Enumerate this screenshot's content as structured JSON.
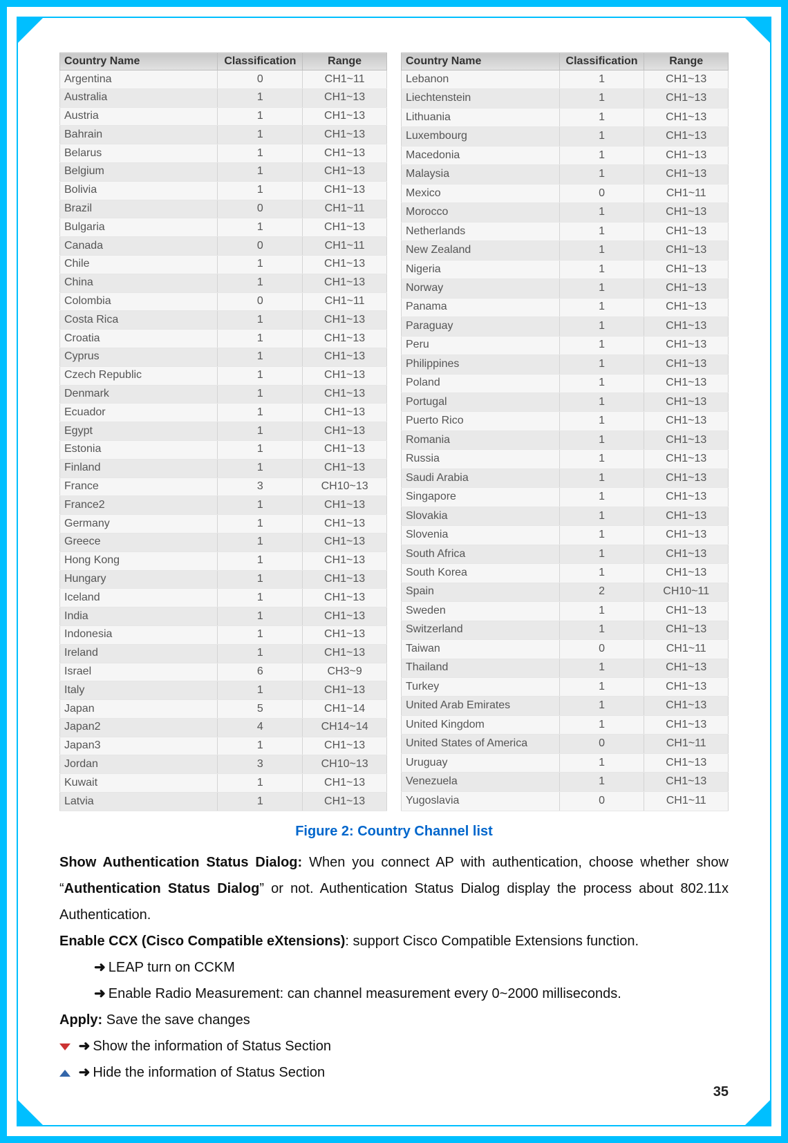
{
  "table": {
    "headers": {
      "country": "Country Name",
      "class": "Classification",
      "range": "Range"
    },
    "left": [
      {
        "n": "Argentina",
        "c": "0",
        "r": "CH1~11"
      },
      {
        "n": "Australia",
        "c": "1",
        "r": "CH1~13"
      },
      {
        "n": "Austria",
        "c": "1",
        "r": "CH1~13"
      },
      {
        "n": "Bahrain",
        "c": "1",
        "r": "CH1~13"
      },
      {
        "n": "Belarus",
        "c": "1",
        "r": "CH1~13"
      },
      {
        "n": "Belgium",
        "c": "1",
        "r": "CH1~13"
      },
      {
        "n": "Bolivia",
        "c": "1",
        "r": "CH1~13"
      },
      {
        "n": "Brazil",
        "c": "0",
        "r": "CH1~11"
      },
      {
        "n": "Bulgaria",
        "c": "1",
        "r": "CH1~13"
      },
      {
        "n": "Canada",
        "c": "0",
        "r": "CH1~11"
      },
      {
        "n": "Chile",
        "c": "1",
        "r": "CH1~13"
      },
      {
        "n": "China",
        "c": "1",
        "r": "CH1~13"
      },
      {
        "n": "Colombia",
        "c": "0",
        "r": "CH1~11"
      },
      {
        "n": "Costa Rica",
        "c": "1",
        "r": "CH1~13"
      },
      {
        "n": "Croatia",
        "c": "1",
        "r": "CH1~13"
      },
      {
        "n": "Cyprus",
        "c": "1",
        "r": "CH1~13"
      },
      {
        "n": "Czech Republic",
        "c": "1",
        "r": "CH1~13"
      },
      {
        "n": "Denmark",
        "c": "1",
        "r": "CH1~13"
      },
      {
        "n": "Ecuador",
        "c": "1",
        "r": "CH1~13"
      },
      {
        "n": "Egypt",
        "c": "1",
        "r": "CH1~13"
      },
      {
        "n": "Estonia",
        "c": "1",
        "r": "CH1~13"
      },
      {
        "n": "Finland",
        "c": "1",
        "r": "CH1~13"
      },
      {
        "n": "France",
        "c": "3",
        "r": "CH10~13"
      },
      {
        "n": "France2",
        "c": "1",
        "r": "CH1~13"
      },
      {
        "n": "Germany",
        "c": "1",
        "r": "CH1~13"
      },
      {
        "n": "Greece",
        "c": "1",
        "r": "CH1~13"
      },
      {
        "n": "Hong Kong",
        "c": "1",
        "r": "CH1~13"
      },
      {
        "n": "Hungary",
        "c": "1",
        "r": "CH1~13"
      },
      {
        "n": "Iceland",
        "c": "1",
        "r": "CH1~13"
      },
      {
        "n": "India",
        "c": "1",
        "r": "CH1~13"
      },
      {
        "n": "Indonesia",
        "c": "1",
        "r": "CH1~13"
      },
      {
        "n": "Ireland",
        "c": "1",
        "r": "CH1~13"
      },
      {
        "n": "Israel",
        "c": "6",
        "r": "CH3~9"
      },
      {
        "n": "Italy",
        "c": "1",
        "r": "CH1~13"
      },
      {
        "n": "Japan",
        "c": "5",
        "r": "CH1~14"
      },
      {
        "n": "Japan2",
        "c": "4",
        "r": "CH14~14"
      },
      {
        "n": "Japan3",
        "c": "1",
        "r": "CH1~13"
      },
      {
        "n": "Jordan",
        "c": "3",
        "r": "CH10~13"
      },
      {
        "n": "Kuwait",
        "c": "1",
        "r": "CH1~13"
      },
      {
        "n": "Latvia",
        "c": "1",
        "r": "CH1~13"
      }
    ],
    "right": [
      {
        "n": "Lebanon",
        "c": "1",
        "r": "CH1~13"
      },
      {
        "n": "Liechtenstein",
        "c": "1",
        "r": "CH1~13"
      },
      {
        "n": "Lithuania",
        "c": "1",
        "r": "CH1~13"
      },
      {
        "n": "Luxembourg",
        "c": "1",
        "r": "CH1~13"
      },
      {
        "n": "Macedonia",
        "c": "1",
        "r": "CH1~13"
      },
      {
        "n": "Malaysia",
        "c": "1",
        "r": "CH1~13"
      },
      {
        "n": "Mexico",
        "c": "0",
        "r": "CH1~11"
      },
      {
        "n": "Morocco",
        "c": "1",
        "r": "CH1~13"
      },
      {
        "n": "Netherlands",
        "c": "1",
        "r": "CH1~13"
      },
      {
        "n": "New Zealand",
        "c": "1",
        "r": "CH1~13"
      },
      {
        "n": "Nigeria",
        "c": "1",
        "r": "CH1~13"
      },
      {
        "n": "Norway",
        "c": "1",
        "r": "CH1~13"
      },
      {
        "n": "Panama",
        "c": "1",
        "r": "CH1~13"
      },
      {
        "n": "Paraguay",
        "c": "1",
        "r": "CH1~13"
      },
      {
        "n": "Peru",
        "c": "1",
        "r": "CH1~13"
      },
      {
        "n": "Philippines",
        "c": "1",
        "r": "CH1~13"
      },
      {
        "n": "Poland",
        "c": "1",
        "r": "CH1~13"
      },
      {
        "n": "Portugal",
        "c": "1",
        "r": "CH1~13"
      },
      {
        "n": "Puerto Rico",
        "c": "1",
        "r": "CH1~13"
      },
      {
        "n": "Romania",
        "c": "1",
        "r": "CH1~13"
      },
      {
        "n": "Russia",
        "c": "1",
        "r": "CH1~13"
      },
      {
        "n": "Saudi Arabia",
        "c": "1",
        "r": "CH1~13"
      },
      {
        "n": "Singapore",
        "c": "1",
        "r": "CH1~13"
      },
      {
        "n": "Slovakia",
        "c": "1",
        "r": "CH1~13"
      },
      {
        "n": "Slovenia",
        "c": "1",
        "r": "CH1~13"
      },
      {
        "n": "South Africa",
        "c": "1",
        "r": "CH1~13"
      },
      {
        "n": "South Korea",
        "c": "1",
        "r": "CH1~13"
      },
      {
        "n": "Spain",
        "c": "2",
        "r": "CH10~11"
      },
      {
        "n": "Sweden",
        "c": "1",
        "r": "CH1~13"
      },
      {
        "n": "Switzerland",
        "c": "1",
        "r": "CH1~13"
      },
      {
        "n": "Taiwan",
        "c": "0",
        "r": "CH1~11"
      },
      {
        "n": "Thailand",
        "c": "1",
        "r": "CH1~13"
      },
      {
        "n": "Turkey",
        "c": "1",
        "r": "CH1~13"
      },
      {
        "n": "United Arab Emirates",
        "c": "1",
        "r": "CH1~13"
      },
      {
        "n": "United Kingdom",
        "c": "1",
        "r": "CH1~13"
      },
      {
        "n": "United States of America",
        "c": "0",
        "r": "CH1~11"
      },
      {
        "n": "Uruguay",
        "c": "1",
        "r": "CH1~13"
      },
      {
        "n": "Venezuela",
        "c": "1",
        "r": "CH1~13"
      },
      {
        "n": "Yugoslavia",
        "c": "0",
        "r": "CH1~11"
      }
    ]
  },
  "caption": "Figure 2: Country Channel list",
  "text": {
    "p1_b1": "Show Authentication Status Dialog:",
    "p1_a": " When you connect AP with authentication, choose whether show “",
    "p1_b2": "Authentication Status Dialog",
    "p1_c": "” or not. Authentication Status Dialog display the process about 802.11x Authentication.",
    "p2_b": "Enable CCX (Cisco Compatible eXtensions)",
    "p2_a": ": support Cisco Compatible Extensions function.",
    "bul1": "LEAP turn on CCKM",
    "bul2": "Enable Radio Measurement: can channel measurement every 0~2000 milliseconds.",
    "p3_b": "Apply:",
    "p3_a": " Save the save changes",
    "bul3": "Show the information of Status Section",
    "bul4": "Hide the information of Status Section",
    "arrow": "➜"
  },
  "page_number": "35"
}
